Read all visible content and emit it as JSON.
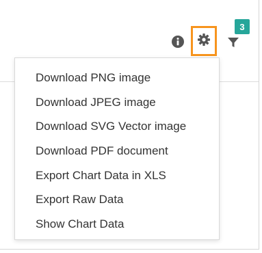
{
  "toolbar": {
    "filter_badge_count": "3",
    "icons": {
      "info": "info-icon",
      "settings": "gear-icon",
      "filter": "filter-icon"
    },
    "accent_color": "#f7941d",
    "badge_color": "#26a69a"
  },
  "export_menu": {
    "items": [
      {
        "label": "Download PNG image"
      },
      {
        "label": "Download JPEG image"
      },
      {
        "label": "Download SVG Vector image"
      },
      {
        "label": "Download PDF document"
      },
      {
        "label": "Export Chart Data in XLS"
      },
      {
        "label": "Export Raw Data"
      },
      {
        "label": "Show Chart Data"
      }
    ]
  }
}
